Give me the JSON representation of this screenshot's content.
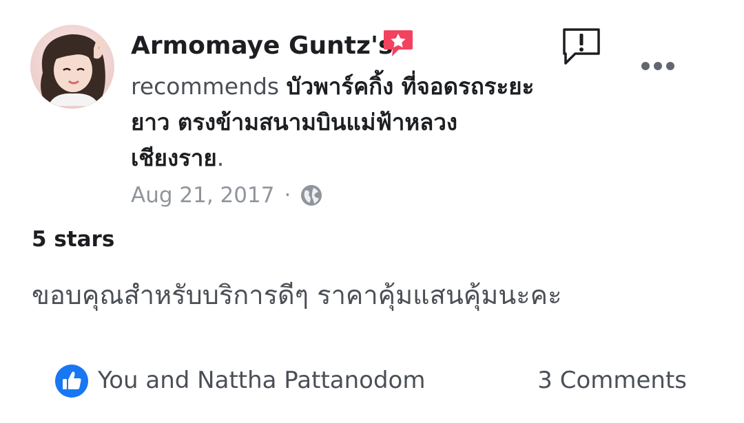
{
  "post": {
    "author_name": "Armomaye Guntz's",
    "recommend_prefix": "recommends ",
    "place_name": "บัวพาร์คกิ้ง ที่จอดรถระยะยาว ตรงข้ามสนามบินแม่ฟ้าหลวง เชียงราย",
    "recommend_suffix": ".",
    "date": "Aug 21, 2017",
    "separator": "·",
    "rating": "5 stars",
    "review_text": "ขอบคุณสำหรับบริการดีๆ ราคาคุ้มแสนคุ้มนะคะ",
    "likers": "You and Nattha Pattanodom",
    "comments": "3 Comments"
  },
  "icons": {
    "recommendation_badge": "star-speech-bubble-icon",
    "report": "report-exclamation-icon",
    "more": "more-options-icon",
    "privacy": "globe-icon",
    "like": "like-thumb-icon"
  },
  "colors": {
    "badge": "#f3425f",
    "like_blue": "#1877f2",
    "name_text": "#1c1e21",
    "body_text": "#4b4f56",
    "meta_text": "#90949c"
  }
}
